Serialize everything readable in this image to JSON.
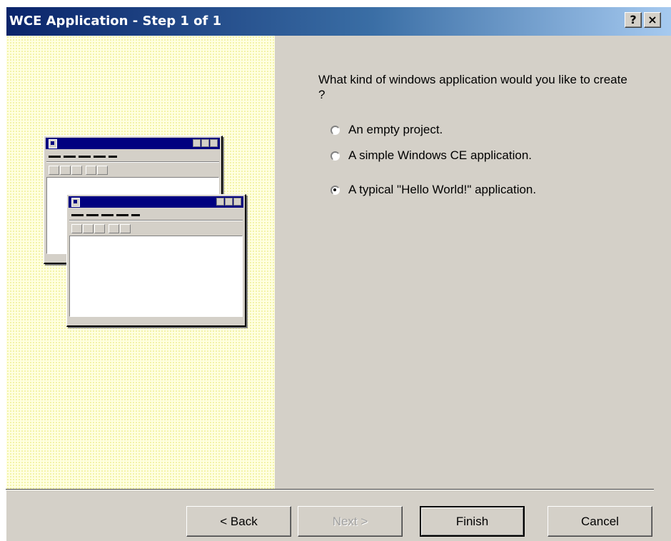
{
  "window": {
    "title": "WCE Application - Step 1 of 1",
    "help_label": "?",
    "close_label": "×"
  },
  "question": "What kind of windows application would you like to create ?",
  "options": [
    {
      "label": "An empty project.",
      "selected": false
    },
    {
      "label": "A simple Windows CE application.",
      "selected": false
    },
    {
      "label": "A typical \"Hello World!\" application.",
      "selected": true
    }
  ],
  "buttons": {
    "back": "< Back",
    "next": "Next >",
    "finish": "Finish",
    "cancel": "Cancel"
  },
  "colors": {
    "title_start": "#0a246a",
    "title_end": "#a6caf0",
    "face": "#d4d0c8",
    "illustration_bg": "#ffffe0"
  }
}
